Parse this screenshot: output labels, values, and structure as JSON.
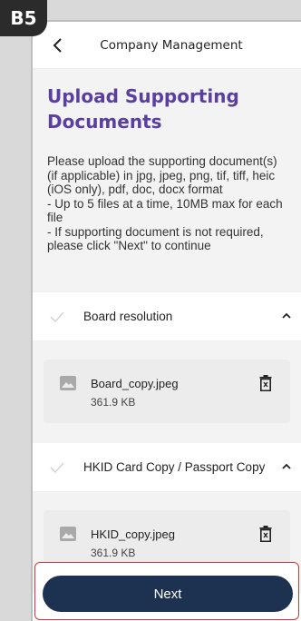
{
  "badge": {
    "label": "B5"
  },
  "header": {
    "title": "Company Management"
  },
  "intro": {
    "title": "Upload Supporting Documents",
    "description": "Please upload the supporting document(s) (if applicable) in jpg, jpeg, png, tif, tiff, heic (iOS only), pdf, doc, docx format\n- Up to 5 files at a time, 10MB max for each file\n- If supporting document is not required, please click \"Next\" to continue"
  },
  "sections": [
    {
      "label": "Board resolution",
      "file": {
        "name": "Board_copy.jpeg",
        "size": "361.9 KB"
      }
    },
    {
      "label": "HKID Card Copy / Passport Copy",
      "file": {
        "name": "HKID_copy.jpeg",
        "size": "361.9 KB"
      }
    }
  ],
  "footer": {
    "next_label": "Next"
  },
  "colors": {
    "title": "#5b3fa0",
    "primary_button": "#1d3150",
    "highlight": "#d0383c"
  },
  "icons": {
    "back": "chevron-left-icon",
    "check": "check-icon",
    "collapse": "chevron-up-icon",
    "file": "image-icon",
    "delete": "trash-icon"
  }
}
